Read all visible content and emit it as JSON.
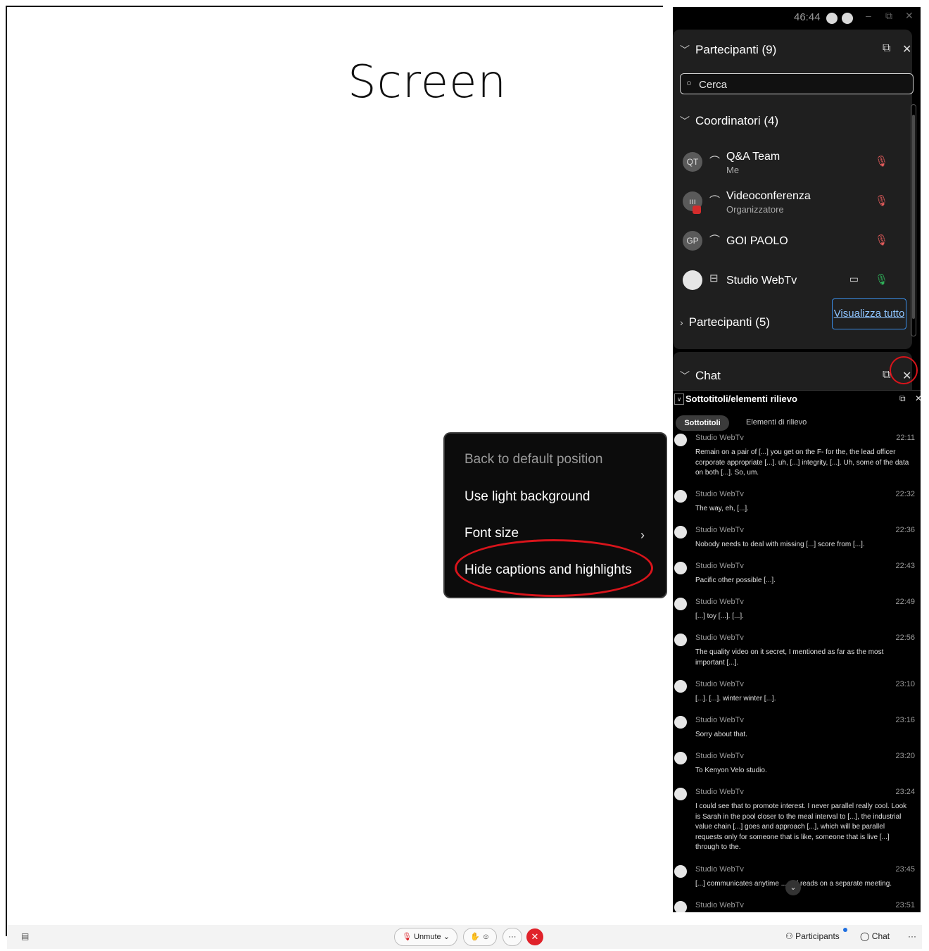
{
  "stage": {
    "title": "Screen"
  },
  "context_menu": {
    "items": [
      {
        "label": "Back to default position",
        "disabled": true
      },
      {
        "label": "Use light background"
      },
      {
        "label": "Font size",
        "has_submenu": true
      },
      {
        "label": "Hide captions and highlights",
        "highlighted": true
      }
    ],
    "submenu_chevron": "›"
  },
  "titlebar": {
    "timer": "46:44",
    "badge1": "◉",
    "badge2": "◉",
    "minimize": "–",
    "restore": "⧉",
    "close": "✕"
  },
  "participants": {
    "title": "Partecipanti (9)",
    "search_placeholder": "Cerca",
    "group_coordinators": "Coordinatori (4)",
    "people": [
      {
        "initials": "QT",
        "name": "Q&A Team",
        "role": "Me",
        "mic": "muted"
      },
      {
        "initials": "III",
        "name": "Videoconferenza",
        "role": "Organizzatore",
        "mic": "muted"
      },
      {
        "initials": "GP",
        "name": "GOI PAOLO",
        "role": "",
        "mic": "muted"
      },
      {
        "initials": "",
        "name": "Studio WebTv",
        "role": "",
        "mic": "on"
      }
    ],
    "group_participants": "Partecipanti (5)",
    "view_all": "Visualizza tutto"
  },
  "chat": {
    "title": "Chat"
  },
  "captions": {
    "title": "Sottotitoli/elementi rilievo",
    "tab_active": "Sottotitoli",
    "tab_other": "Elementi di rilievo",
    "messages": [
      {
        "name": "Studio WebTv",
        "time": "22:11",
        "text": "Remain on a pair of [...] you get on the F- for the, the lead officer corporate appropriate [...]. uh, [...] integrity, [...]. Uh, some of the data on both [...]. So, um."
      },
      {
        "name": "Studio WebTv",
        "time": "22:32",
        "text": "The way, eh, [...]."
      },
      {
        "name": "Studio WebTv",
        "time": "22:36",
        "text": "Nobody needs to deal with missing [...] score from [...]."
      },
      {
        "name": "Studio WebTv",
        "time": "22:43",
        "text": "Pacific other possible [...]."
      },
      {
        "name": "Studio WebTv",
        "time": "22:49",
        "text": "[...] toy [...]. [...]."
      },
      {
        "name": "Studio WebTv",
        "time": "22:56",
        "text": "The quality video on it secret, I mentioned as far as the most important [...]."
      },
      {
        "name": "Studio WebTv",
        "time": "23:10",
        "text": "[...]. [...]. winter winter [...]."
      },
      {
        "name": "Studio WebTv",
        "time": "23:16",
        "text": "Sorry about that."
      },
      {
        "name": "Studio WebTv",
        "time": "23:20",
        "text": "To Kenyon Velo studio."
      },
      {
        "name": "Studio WebTv",
        "time": "23:24",
        "text": "I could see that to promote interest. I never parallel really cool. Look is Sarah in the pool closer to the meal interval to [...], the industrial value chain [...] goes and approach [...], which will be parallel requests only for someone that is like, someone that is live [...] through to the."
      },
      {
        "name": "Studio WebTv",
        "time": "23:45",
        "text": "[...] communicates anytime ... eal reads on a separate meeting."
      },
      {
        "name": "Studio WebTv",
        "time": "23:51",
        "text": ""
      }
    ]
  },
  "bottombar": {
    "unmute": "Unmute",
    "participants": "Participants",
    "chat": "Chat",
    "more": "···",
    "end": "✕"
  },
  "colors": {
    "accent_red": "#d8141b",
    "link_blue": "#3a8ee8",
    "mic_green": "#2fb35a"
  }
}
